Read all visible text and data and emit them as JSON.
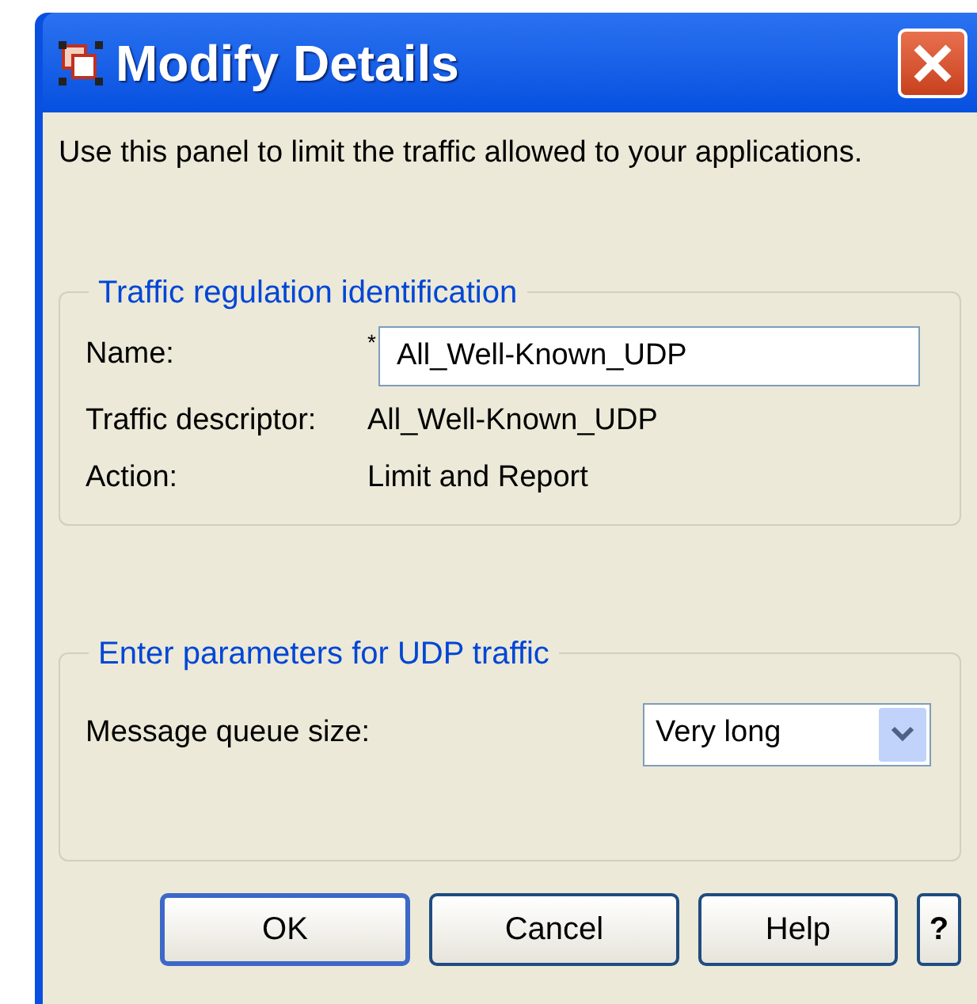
{
  "window": {
    "title": "Modify Details"
  },
  "intro": "Use this panel to limit the traffic allowed to your applications.",
  "identification": {
    "title": "Traffic regulation identification",
    "name": {
      "label": "Name:",
      "required_mark": "*",
      "value": "All_Well-Known_UDP"
    },
    "fields": [
      {
        "label": "Traffic descriptor:",
        "value": "All_Well-Known_UDP"
      },
      {
        "label": "Action:",
        "value": "Limit and Report"
      }
    ]
  },
  "parameters": {
    "title": "Enter parameters for UDP traffic",
    "queue": {
      "label": "Message queue size:",
      "value": "Very long"
    }
  },
  "buttons": [
    {
      "label": "OK",
      "default": true
    },
    {
      "label": "Cancel",
      "default": false
    },
    {
      "label": "Help",
      "default": false
    }
  ],
  "help_button": "?"
}
